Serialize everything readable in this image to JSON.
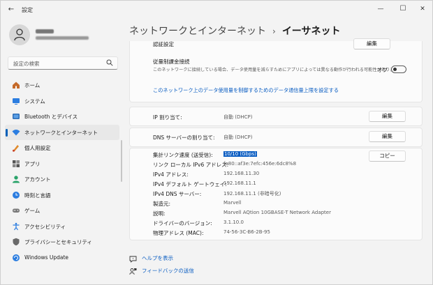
{
  "window": {
    "title": "設定",
    "back_glyph": "←",
    "min_glyph": "—",
    "max_glyph": "☐",
    "close_glyph": "✕"
  },
  "profile": {
    "name_redacted": true,
    "email_redacted": true
  },
  "search": {
    "placeholder": "設定の検索"
  },
  "sidebar": {
    "items": [
      {
        "label": "ホーム",
        "icon": "home-icon",
        "active": false
      },
      {
        "label": "システム",
        "icon": "system-icon",
        "active": false
      },
      {
        "label": "Bluetooth とデバイス",
        "icon": "bluetooth-icon",
        "active": false
      },
      {
        "label": "ネットワークとインターネット",
        "icon": "network-icon",
        "active": true
      },
      {
        "label": "個人用設定",
        "icon": "personalization-icon",
        "active": false
      },
      {
        "label": "アプリ",
        "icon": "apps-icon",
        "active": false
      },
      {
        "label": "アカウント",
        "icon": "account-icon",
        "active": false
      },
      {
        "label": "時刻と言語",
        "icon": "time-language-icon",
        "active": false
      },
      {
        "label": "ゲーム",
        "icon": "gaming-icon",
        "active": false
      },
      {
        "label": "アクセシビリティ",
        "icon": "accessibility-icon",
        "active": false
      },
      {
        "label": "プライバシーとセキュリティ",
        "icon": "privacy-icon",
        "active": false
      },
      {
        "label": "Windows Update",
        "icon": "windows-update-icon",
        "active": false
      }
    ]
  },
  "breadcrumb": {
    "parent": "ネットワークとインターネット",
    "separator": "›",
    "current": "イーサネット"
  },
  "auth": {
    "label": "認証設定",
    "button": "編集"
  },
  "metered": {
    "label": "従量制課金接続",
    "description": "このネットワークに接続している場合、データ使用量を減らすためにアプリによっては異なる動作が行われる可能性があります",
    "toggle_state": "オフ",
    "link": "このネットワーク上のデータ使用量を制御するためのデータ通信量上限を設定する"
  },
  "ip": {
    "label": "IP 割り当て:",
    "value": "自動 (DHCP)",
    "button": "編集"
  },
  "dns": {
    "label": "DNS サーバーの割り当て:",
    "value": "自動 (DHCP)",
    "button": "編集"
  },
  "properties": {
    "copy_button": "コピー",
    "rows": [
      {
        "label": "集計リンク速度 (送受信):",
        "value": "10/10 (Gbps)",
        "selected": true
      },
      {
        "label": "リンク ローカル IPv6 アドレス:",
        "value": "fe80::af3e:7efc:456e:6dc8%8"
      },
      {
        "label": "IPv4 アドレス:",
        "value": "192.168.11.30"
      },
      {
        "label": "IPv4 デフォルト ゲートウェイ:",
        "value": "192.168.11.1"
      },
      {
        "label": "IPv4 DNS サーバー:",
        "value": "192.168.11.1 (非暗号化)"
      },
      {
        "label": "製造元:",
        "value": "Marvell"
      },
      {
        "label": "説明:",
        "value": "Marvell AQtion 10GBASE-T Network Adapter"
      },
      {
        "label": "ドライバーのバージョン:",
        "value": "3.1.10.0"
      },
      {
        "label": "物理アドレス (MAC):",
        "value": "74-56-3C-B6-2B-95"
      }
    ]
  },
  "footer": {
    "help": "ヘルプを表示",
    "feedback": "フィードバックの送信"
  },
  "colors": {
    "accent": "#005fb8",
    "link": "#0a5dc2",
    "background": "#f3f3f3",
    "card": "#fbfbfb"
  }
}
